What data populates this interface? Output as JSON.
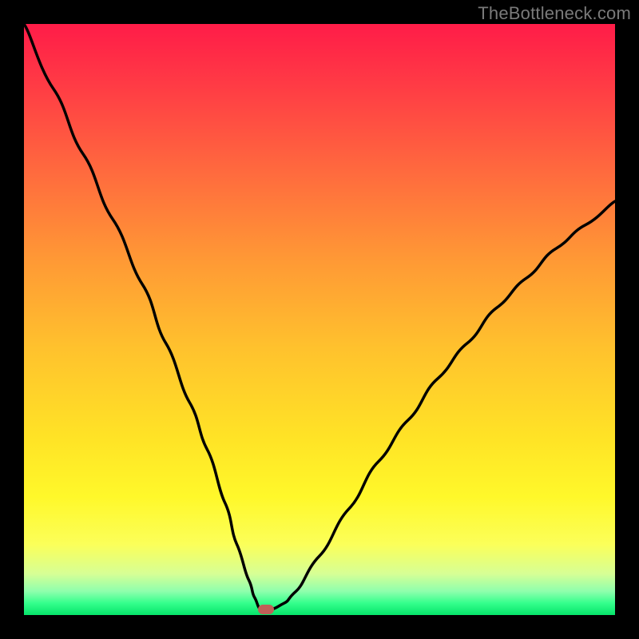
{
  "watermark": "TheBottleneck.com",
  "colors": {
    "frame": "#000000",
    "curve": "#000000",
    "marker": "#c06058"
  },
  "chart_data": {
    "type": "line",
    "title": "",
    "xlabel": "",
    "ylabel": "",
    "xlim": [
      0,
      100
    ],
    "ylim": [
      0,
      100
    ],
    "grid": false,
    "legend": false,
    "annotations": [
      "TheBottleneck.com"
    ],
    "series": [
      {
        "name": "curve",
        "x": [
          0,
          5,
          10,
          15,
          20,
          24,
          28,
          31,
          34,
          36,
          38,
          39,
          40,
          41,
          42,
          44,
          46,
          50,
          55,
          60,
          65,
          70,
          75,
          80,
          85,
          90,
          95,
          100
        ],
        "values": [
          100,
          89,
          78,
          67,
          56,
          46,
          36,
          28,
          19,
          12,
          6,
          3,
          1,
          1,
          1,
          2,
          4,
          10,
          18,
          26,
          33,
          40,
          46,
          52,
          57,
          62,
          66,
          70
        ]
      }
    ],
    "marker": {
      "x": 41,
      "y": 1
    },
    "background_gradient": {
      "stops": [
        {
          "pos": 0.0,
          "color": "#ff1c48"
        },
        {
          "pos": 0.1,
          "color": "#ff3a45"
        },
        {
          "pos": 0.25,
          "color": "#ff6a3e"
        },
        {
          "pos": 0.4,
          "color": "#ff9935"
        },
        {
          "pos": 0.55,
          "color": "#ffc22d"
        },
        {
          "pos": 0.7,
          "color": "#ffe326"
        },
        {
          "pos": 0.8,
          "color": "#fff82a"
        },
        {
          "pos": 0.88,
          "color": "#fbff59"
        },
        {
          "pos": 0.93,
          "color": "#d7ff95"
        },
        {
          "pos": 0.96,
          "color": "#8effad"
        },
        {
          "pos": 0.98,
          "color": "#34ff8c"
        },
        {
          "pos": 1.0,
          "color": "#06e46a"
        }
      ]
    }
  }
}
